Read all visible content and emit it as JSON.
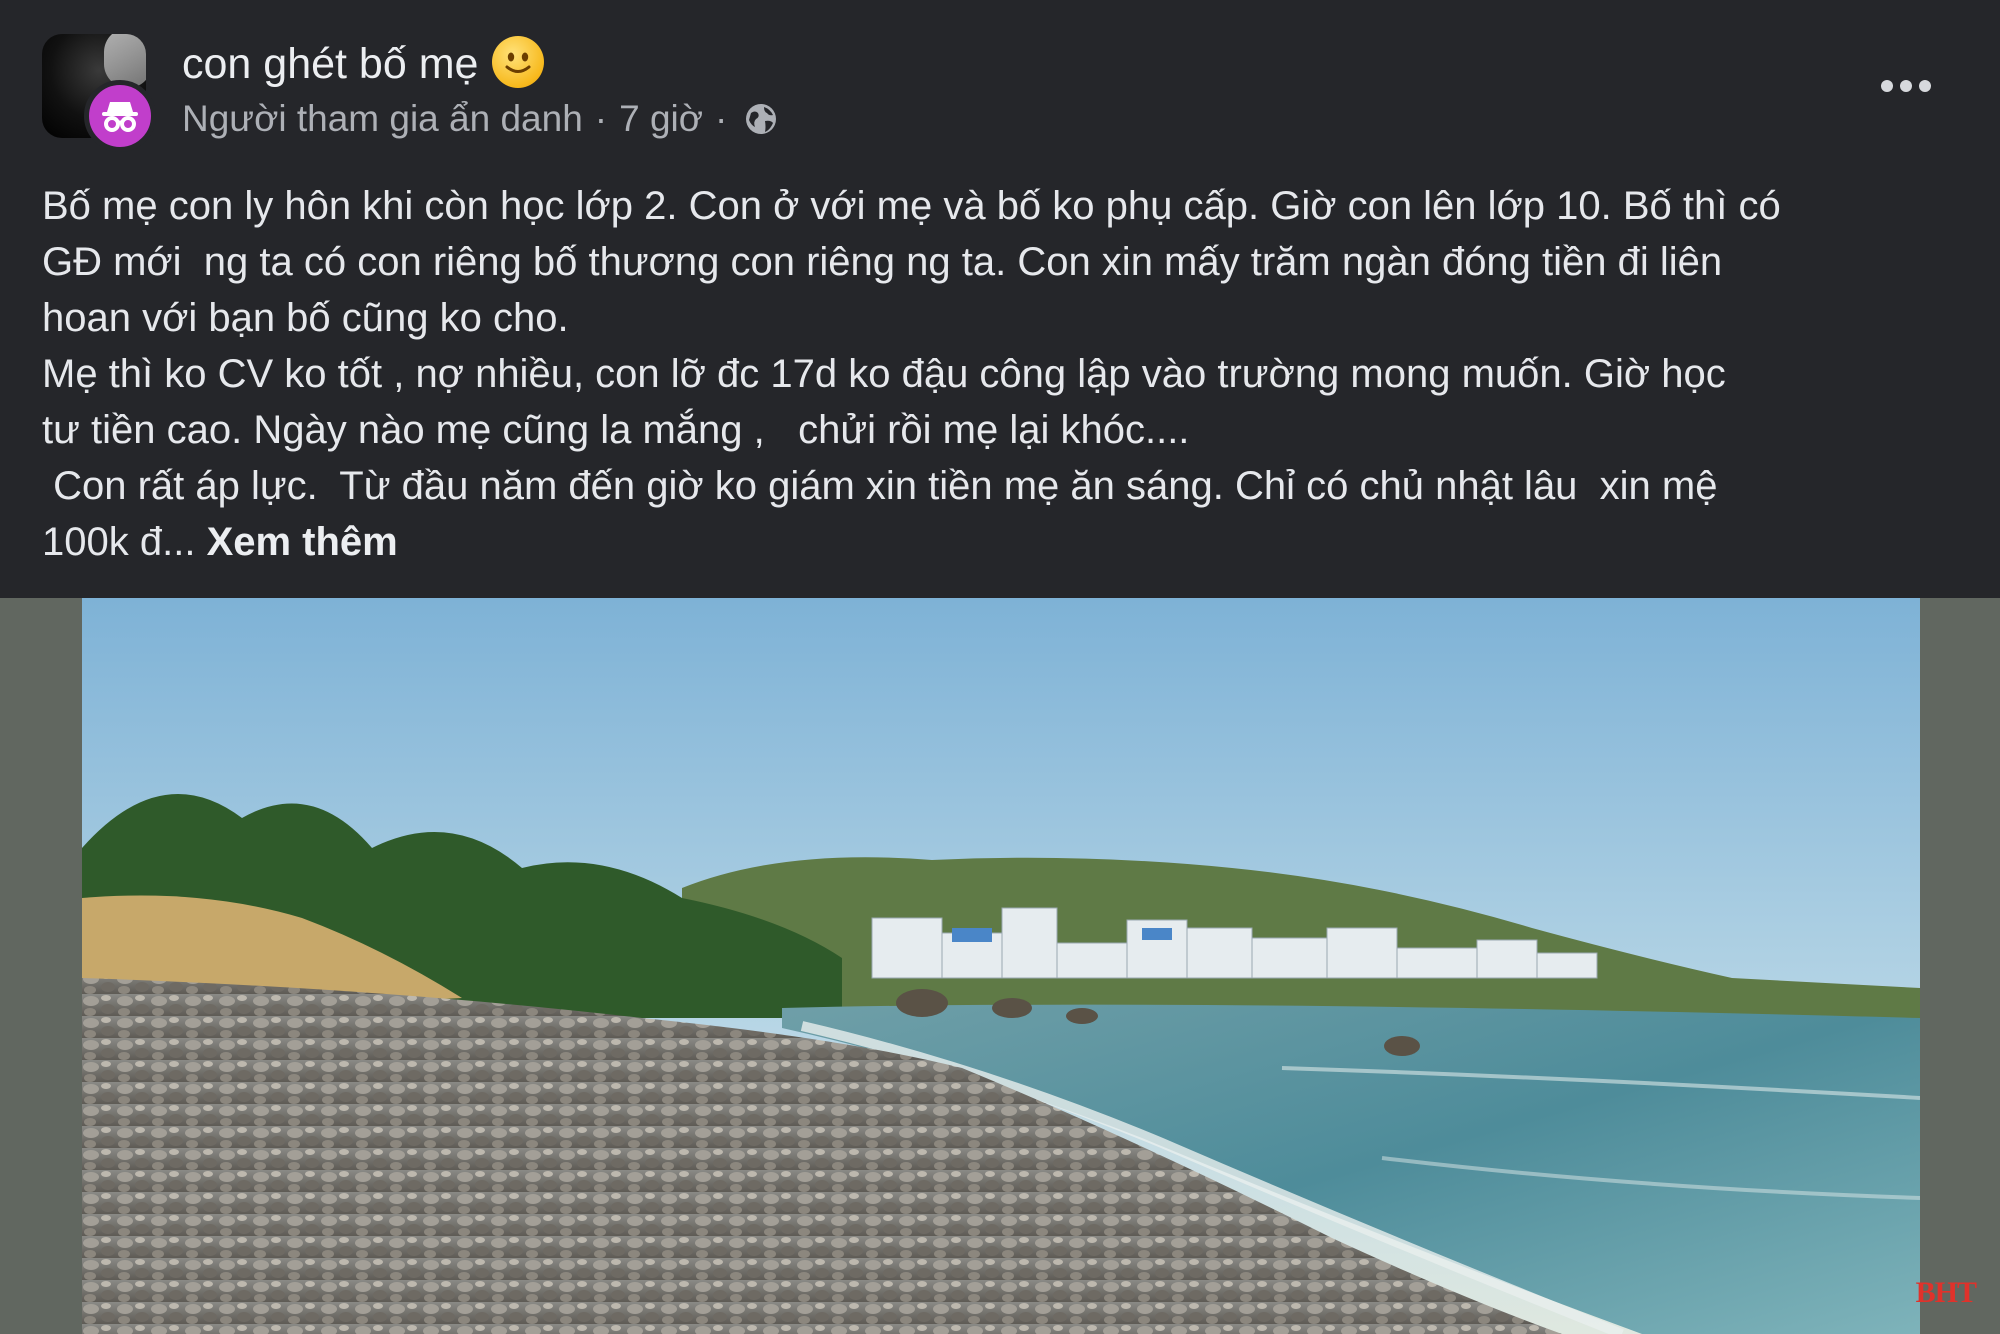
{
  "post": {
    "author_name": "con ghét bố mẹ",
    "author_role": "Người tham gia ẩn danh",
    "separator": "·",
    "time": "7 giờ",
    "audience_icon": "globe-icon",
    "emoji_icon": "slightly-smiling-face-icon",
    "more_icon": "more-options-icon",
    "text_lines": [
      "Bố mẹ con ly hôn khi còn học lớp 2. Con ở với mẹ và bố ko phụ cấp. Giờ con lên lớp 10. Bố thì có",
      "GĐ mới  ng ta có con riêng bố thương con riêng ng ta. Con xin mấy trăm ngàn đóng tiền đi liên",
      "hoan với bạn bố cũng ko cho.",
      "Mẹ thì ko CV ko tốt , nợ nhiều, con lỡ đc 17d ko đậu công lập vào trường mong muốn. Giờ học",
      "tư tiền cao. Ngày nào mẹ cũng la mắng ,   chửi rồi mẹ lại khóc....",
      " Con rất áp lực.  Từ đầu năm đến giờ ko giám xin tiền mẹ ăn sáng. Chỉ có chủ nhật lâu  xin mệ"
    ],
    "last_line_prefix": "100k đ... ",
    "see_more_label": "Xem thêm"
  },
  "image": {
    "watermark": "BHT"
  },
  "colors": {
    "background": "#25262a",
    "anonymous_badge": "#c13ecb",
    "text_primary": "#e6e8ec",
    "text_secondary": "#adb0b6",
    "image_letterbox": "#616760",
    "watermark": "#e0322b"
  }
}
